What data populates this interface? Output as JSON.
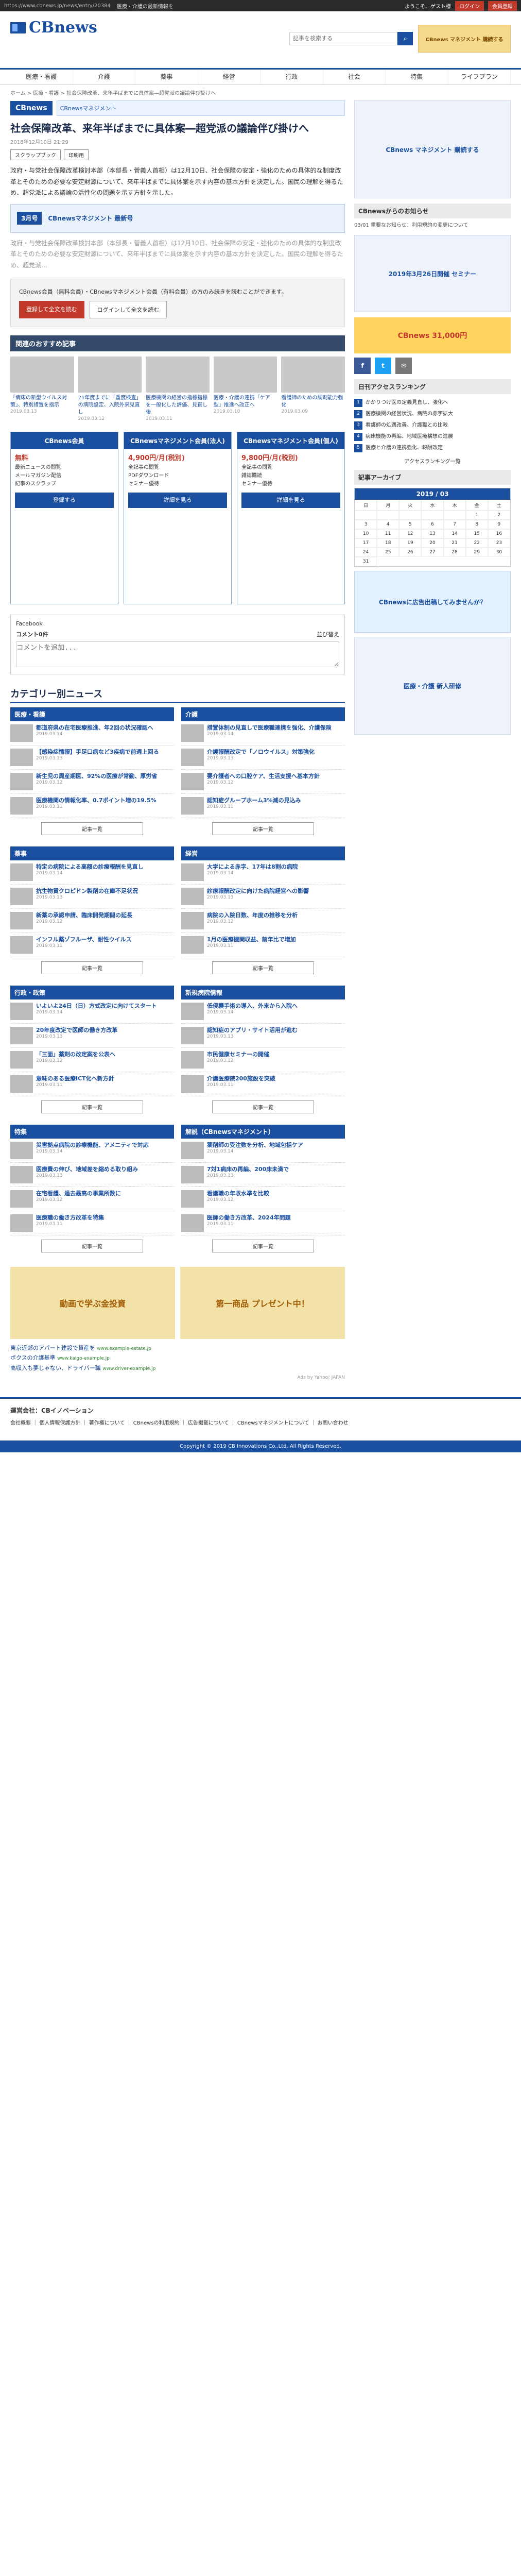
{
  "utility": {
    "url": "https://www.cbnews.jp/news/entry/20384",
    "links": [
      "医療・介護の最新情報を",
      "ようこそ、ゲスト様"
    ],
    "buttons": [
      "ログイン",
      "会員登録"
    ]
  },
  "header": {
    "logo": "CBnews",
    "search_placeholder": "記事を検索する",
    "search_button": "検索",
    "banner": "CBnews マネジメント 購読する"
  },
  "nav": [
    "医療・看護",
    "介護",
    "薬事",
    "経営",
    "行政",
    "社会",
    "特集",
    "ライフプラン"
  ],
  "breadcrumb": "ホーム > 医療・看護 > 社会保障改革、来年半ばまでに具体案―超党派の議論伴び掛けへ",
  "article": {
    "badge": "CBnews",
    "promo": "CBnewsマネジメント",
    "title": "社会保障改革、来年半ばまでに具体案―超党派の議論伴び掛けへ",
    "date": "2018年12月10日 21:29",
    "tools": [
      "スクラップブック",
      "印刷用"
    ],
    "paragraphs": [
      "政府・与党社会保障改革検討本部（本部長・菅義人首相）は12月10日、社会保障の安定・強化のための具体的な制度改革とそのための必要な安定財源について、来年半ばまでに具体案を示す内容の基本方針を決定した。国民の理解を得るため、超党派による議論の活性化の問題を示す方針を示した。",
      "政府・与党社会保障改革検討本部（本部長・菅義人首相）は12月10日、社会保障の安定・強化のための具体的な制度改革とそのための必要な安定財源について、来年半ばまでに具体案を示す内容の基本方針を決定した。国民の理解を得るため、超党派…"
    ],
    "mid_banner_tag": "3月号",
    "mid_banner_text": "CBnewsマネジメント 最新号",
    "paywall_text": "CBnews会員（無料会員）・CBnewsマネジメント会員（有料会員）の方のみ続きを読むことができます。",
    "paywall_buttons": [
      "登録して全文を読む",
      "ログインして全文を読む"
    ]
  },
  "recommend": {
    "title": "関連のおすすめ記事",
    "items": [
      {
        "caption": "「病床の新型ウイルス対策」、特別措置を指示",
        "date": "2019.03.13"
      },
      {
        "caption": "21年度までに「重度検査」の病院設定、入院外来見直し",
        "date": "2019.03.12"
      },
      {
        "caption": "医療機関の経営の指標指標を一般化した評価、見直し後",
        "date": "2019.03.11"
      },
      {
        "caption": "医療・介護の連携「ケア型」推進へ改正へ",
        "date": "2019.03.10"
      },
      {
        "caption": "看護師のための調剤能力強化",
        "date": "2019.03.09"
      }
    ]
  },
  "plans": [
    {
      "name": "CBnews会員",
      "fee": "無料",
      "features": [
        "最新ニュースの閲覧",
        "メールマガジン配信",
        "記事のスクラップ"
      ],
      "join": "登録する"
    },
    {
      "name": "CBnewsマネジメント会員(法人)",
      "fee": "4,900円/月(税別)",
      "features": [
        "全記事の閲覧",
        "PDFダウンロード",
        "セミナー優待"
      ],
      "join": "詳細を見る"
    },
    {
      "name": "CBnewsマネジメント会員(個人)",
      "fee": "9,800円/月(税別)",
      "features": [
        "全記事の閲覧",
        "雑誌購読",
        "セミナー優待"
      ],
      "join": "詳細を見る"
    }
  ],
  "facebook": {
    "label": "Facebook",
    "count_label": "コメント0件",
    "sort_label": "並び替え",
    "placeholder": "コメントを追加..."
  },
  "categories": {
    "title": "カテゴリー別ニュース",
    "boxes": [
      {
        "name": "医療・看護",
        "items": [
          {
            "h": "都道府県の在宅医療推進、年2回の状況確認へ",
            "d": "2019.03.14"
          },
          {
            "h": "【感染症情報】手足口病など3疾病で前週上回る",
            "d": "2019.03.13"
          },
          {
            "h": "新生児の周産期医、92%の医療が常勤、厚労省",
            "d": "2019.03.12"
          },
          {
            "h": "医療機関の情報化率、0.7ポイント増の19.5%",
            "d": "2019.03.11"
          }
        ]
      },
      {
        "name": "介護",
        "items": [
          {
            "h": "措置体制の見直しで医療職連携を強化、介護保険",
            "d": "2019.03.14"
          },
          {
            "h": "介護報酬改定で「ノロウイルス」対策強化",
            "d": "2019.03.13"
          },
          {
            "h": "要介護者への口腔ケア、生活支援へ基本方針",
            "d": "2019.03.12"
          },
          {
            "h": "認知症グループホーム3%減の見込み",
            "d": "2019.03.11"
          }
        ]
      },
      {
        "name": "薬事",
        "items": [
          {
            "h": "特定の病院による高額の診療報酬を見直し",
            "d": "2019.03.14"
          },
          {
            "h": "抗生物質クロピドン製剤の在庫不足状況",
            "d": "2019.03.13"
          },
          {
            "h": "新薬の承認申請、臨床開発期間の延長",
            "d": "2019.03.12"
          },
          {
            "h": "インフル薬ゾフルーザ、耐性ウイルス",
            "d": "2019.03.11"
          }
        ]
      },
      {
        "name": "経営",
        "items": [
          {
            "h": "大学による赤字、17年は8割の病院",
            "d": "2019.03.14"
          },
          {
            "h": "診療報酬改定に向けた病院経営への影響",
            "d": "2019.03.13"
          },
          {
            "h": "病院の入院日数、年度の推移を分析",
            "d": "2019.03.12"
          },
          {
            "h": "1月の医療機関収益、前年比で増加",
            "d": "2019.03.11"
          }
        ]
      },
      {
        "name": "行政・政策",
        "items": [
          {
            "h": "いよいよ24日（日）方式改定に向けてスタート",
            "d": "2019.03.14"
          },
          {
            "h": "20年度改定で医師の働き方改革",
            "d": "2019.03.13"
          },
          {
            "h": "「三面」薬剤の改定案を公表へ",
            "d": "2019.03.12"
          },
          {
            "h": "意味のある医療ICT化へ新方針",
            "d": "2019.03.11"
          }
        ]
      },
      {
        "name": "新規病院情報",
        "items": [
          {
            "h": "低侵襲手術の導入、外来から入院へ",
            "d": "2019.03.14"
          },
          {
            "h": "認知症のアプリ・サイト活用が進む",
            "d": "2019.03.13"
          },
          {
            "h": "市民健康セミナーの開催",
            "d": "2019.03.12"
          },
          {
            "h": "介護医療院200施設を突破",
            "d": "2019.03.11"
          }
        ]
      },
      {
        "name": "特集",
        "items": [
          {
            "h": "災害拠点病院の診療機能、アメニティで対応",
            "d": "2019.03.14"
          },
          {
            "h": "医療費の伸び、地域差を縮める取り組み",
            "d": "2019.03.13"
          },
          {
            "h": "在宅看護、過去最高の事業所数に",
            "d": "2019.03.12"
          },
          {
            "h": "医療職の働き方改革を特集",
            "d": "2019.03.11"
          }
        ]
      },
      {
        "name": "解説（CBnewsマネジメント）",
        "items": [
          {
            "h": "薬剤師の受注数を分析、地域包括ケア",
            "d": "2019.03.14"
          },
          {
            "h": "7対1病床の再編、200床未満で",
            "d": "2019.03.13"
          },
          {
            "h": "看護職の年収水準を比較",
            "d": "2019.03.12"
          },
          {
            "h": "医師の働き方改革、2024年問題",
            "d": "2019.03.11"
          }
        ]
      }
    ],
    "more_label": "記事一覧"
  },
  "ads": {
    "tiles": [
      "動画で学ぶ金投資",
      "第一商品 プレゼント中！"
    ],
    "links": [
      {
        "title": "東京近郊のアパート建設で資産を",
        "src": "www.example-estate.jp"
      },
      {
        "title": "ボクスの介護基準",
        "src": "www.kaigo-example.jp"
      },
      {
        "title": "高収入も夢じゃない、ドライバー職",
        "src": "www.driver-example.jp"
      }
    ],
    "credit": "Ads by Yahoo! JAPAN"
  },
  "sidebar": {
    "top_ad": "CBnews マネジメント 購読する",
    "notice_title": "CBnewsからのお知らせ",
    "notices": [
      "03/01 重要なお知らせ：利用規約の変更について"
    ],
    "seminar_ad": "2019年3月26日開催 セミナー",
    "promo": "CBnews 31,000円",
    "ranking_title": "日刊アクセスランキング",
    "ranking": [
      "かかりつけ医の定義見直し、強化へ",
      "医療機関の経営状況、病院の赤字拡大",
      "看護師の処遇改善、介護職との比較",
      "病床機能の再編、地域医療構想の進展",
      "医療と介護の連携強化、報酬改定"
    ],
    "ranking_more": "アクセスランキング一覧",
    "archive_title": "記事アーカイブ",
    "calendar_month": "2019 / 03",
    "calendar_days": [
      "日",
      "月",
      "火",
      "水",
      "木",
      "金",
      "土",
      "",
      "",
      "",
      "",
      "",
      "1",
      "2",
      "3",
      "4",
      "5",
      "6",
      "7",
      "8",
      "9",
      "10",
      "11",
      "12",
      "13",
      "14",
      "15",
      "16",
      "17",
      "18",
      "19",
      "20",
      "21",
      "22",
      "23",
      "24",
      "25",
      "26",
      "27",
      "28",
      "29",
      "30",
      "31"
    ],
    "wide_ad": "CBnewsに広告出稿してみませんか？",
    "bottom_ad": "医療・介護 新人研修",
    "social": [
      "f",
      "t",
      "✉"
    ]
  },
  "footer": {
    "company": "運営会社：CBイノベーション",
    "links": "会社概要 ｜ 個人情報保護方針 ｜ 著作権について ｜ CBnewsの利用規約 ｜ 広告掲載について ｜ CBnewsマネジメントについて ｜ お問い合わせ",
    "copyright": "Copyright © 2019 CB Innovations Co.,Ltd. All Rights Reserved."
  }
}
